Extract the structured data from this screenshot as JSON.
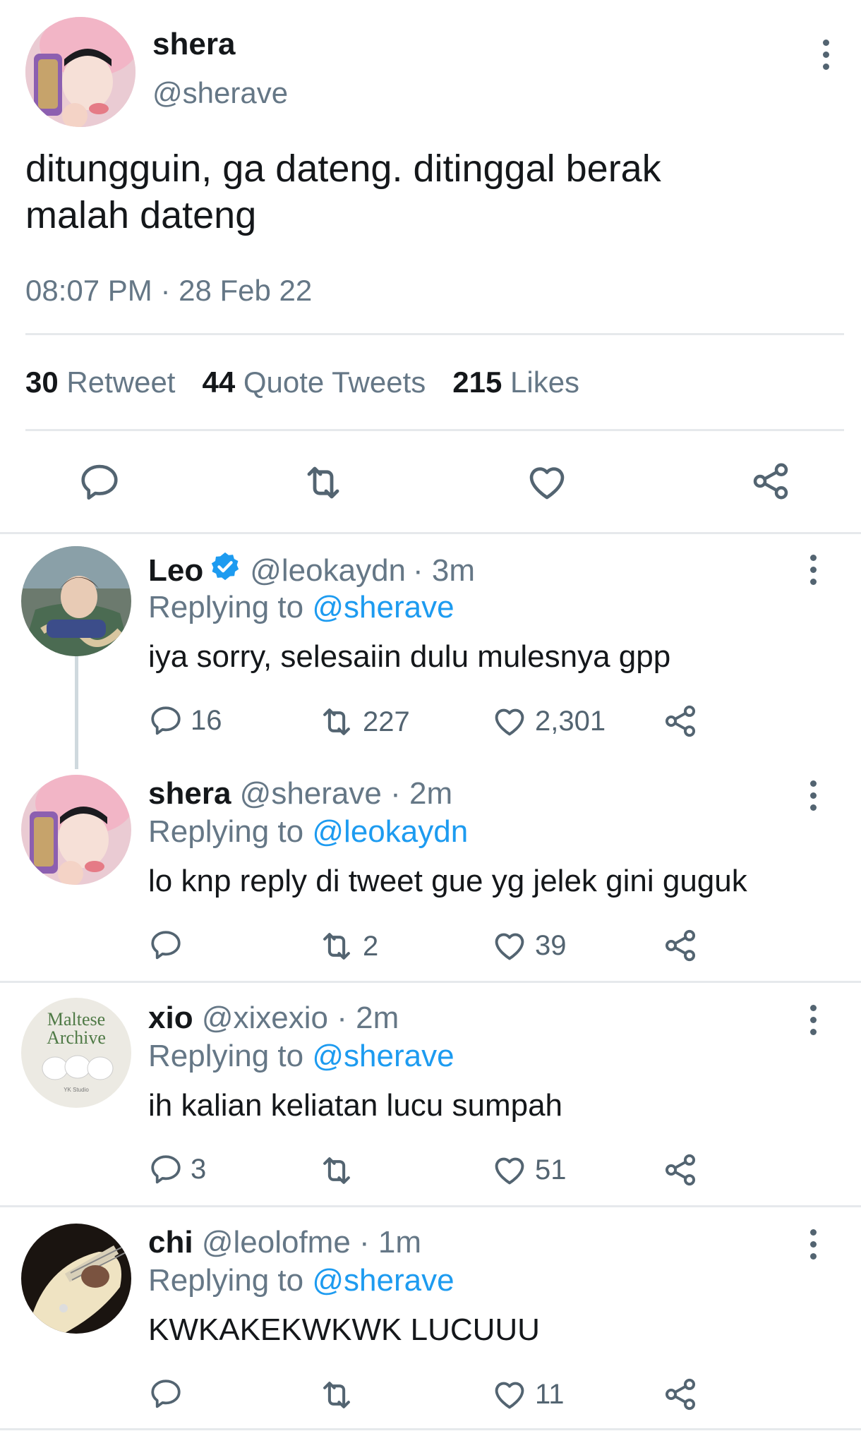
{
  "main_tweet": {
    "display_name": "shera",
    "handle": "@sherave",
    "text": "ditungguin, ga dateng. ditinggal berak malah dateng",
    "timestamp": "08:07 PM · 28 Feb 22",
    "stats": {
      "retweets_count": "30",
      "retweets_label": "Retweet",
      "quotes_count": "44",
      "quotes_label": "Quote Tweets",
      "likes_count": "215",
      "likes_label": "Likes"
    }
  },
  "replies": [
    {
      "display_name": "Leo",
      "verified": true,
      "handle": "@leokaydn",
      "time": "· 3m",
      "replying_prefix": "Replying to",
      "replying_to": "@sherave",
      "text": "iya sorry, selesaiin dulu mulesnya gpp",
      "reply_count": "16",
      "retweet_count": "227",
      "like_count": "2,301"
    },
    {
      "display_name": "shera",
      "verified": false,
      "handle": "@sherave",
      "time": "· 2m",
      "replying_prefix": "Replying to",
      "replying_to": "@leokaydn",
      "text": "lo knp reply di tweet gue yg jelek gini guguk",
      "reply_count": "",
      "retweet_count": "2",
      "like_count": "39"
    },
    {
      "display_name": "xio",
      "verified": false,
      "handle": "@xixexio",
      "time": "· 2m",
      "replying_prefix": "Replying to",
      "replying_to": "@sherave",
      "text": "ih kalian keliatan lucu sumpah",
      "avatar_text_1": "Maltese",
      "avatar_text_2": "Archive",
      "avatar_text_3": "YK Studio",
      "reply_count": "3",
      "retweet_count": "",
      "like_count": "51"
    },
    {
      "display_name": "chi",
      "verified": false,
      "handle": "@leolofme",
      "time": "· 1m",
      "replying_prefix": "Replying to",
      "replying_to": "@sherave",
      "text": "KWKAKEKWKWK LUCUUU",
      "reply_count": "",
      "retweet_count": "",
      "like_count": "11"
    }
  ],
  "colors": {
    "link": "#1d9bf0",
    "secondary": "#657786",
    "verified": "#1d9bf0"
  }
}
